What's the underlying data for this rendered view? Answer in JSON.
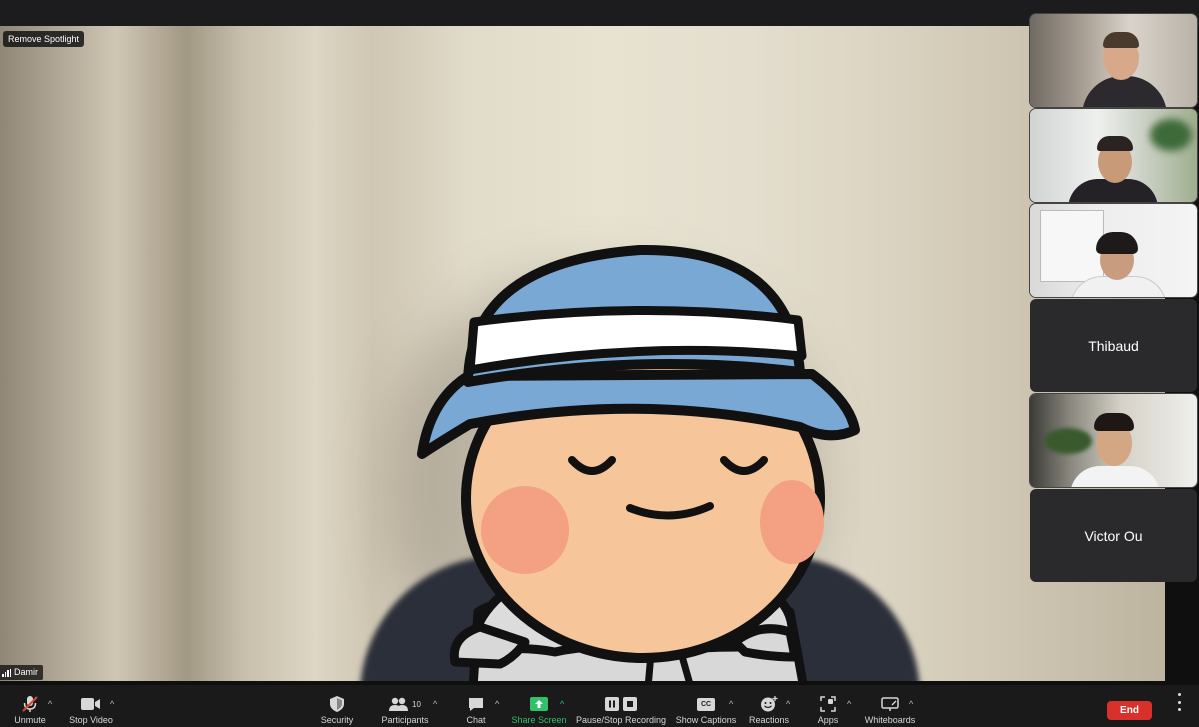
{
  "main": {
    "remove_spotlight_label": "Remove Spotlight",
    "speaker_name": "Damir"
  },
  "participants": [
    {
      "name": "",
      "has_video": true
    },
    {
      "name": "",
      "has_video": true
    },
    {
      "name": "",
      "has_video": true
    },
    {
      "name": "Thibaud",
      "has_video": false
    },
    {
      "name": "",
      "has_video": true
    },
    {
      "name": "Victor Ou",
      "has_video": false
    }
  ],
  "toolbar": {
    "unmute": "Unmute",
    "stop_video": "Stop Video",
    "security": "Security",
    "participants": "Participants",
    "participants_count": "10",
    "chat": "Chat",
    "share_screen": "Share Screen",
    "recording": "Pause/Stop Recording",
    "captions": "Show Captions",
    "captions_badge": "CC",
    "reactions": "Reactions",
    "apps": "Apps",
    "whiteboards": "Whiteboards",
    "end": "End"
  },
  "colors": {
    "share_green": "#2fc26b",
    "end_red": "#d8312c",
    "toolbar_bg": "#1a1a1a"
  }
}
